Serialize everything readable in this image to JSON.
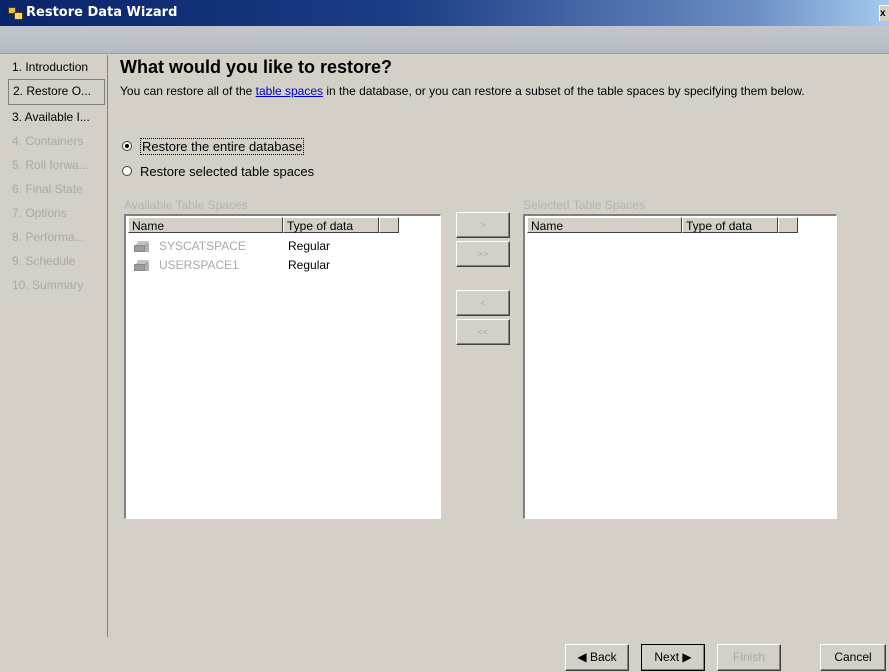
{
  "window": {
    "title": "Restore Data Wizard",
    "close_glyph": "x"
  },
  "nav": {
    "items": [
      {
        "label": "1. Introduction"
      },
      {
        "label": "2. Restore O..."
      },
      {
        "label": "3. Available I..."
      },
      {
        "label": "4. Containers"
      },
      {
        "label": "5. Roll forwa..."
      },
      {
        "label": "6. Final State"
      },
      {
        "label": "7. Options"
      },
      {
        "label": "8. Performa..."
      },
      {
        "label": "9. Schedule"
      },
      {
        "label": "10. Summary"
      }
    ]
  },
  "page": {
    "title": "What would you like to restore?",
    "desc_before": "You can restore all of the ",
    "desc_link": "table spaces",
    "desc_after": " in the database, or you can restore a subset of the table spaces by specifying them below."
  },
  "options": {
    "entire": "Restore the entire database",
    "selected": "Restore selected table spaces"
  },
  "available": {
    "label": "Available Table Spaces",
    "columns": [
      "Name",
      "Type of data"
    ],
    "rows": [
      {
        "name": "SYSCATSPACE",
        "type": "Regular"
      },
      {
        "name": "USERSPACE1",
        "type": "Regular"
      }
    ]
  },
  "selected": {
    "label": "Selected Table Spaces",
    "columns": [
      "Name",
      "Type of data"
    ]
  },
  "transfer": {
    "add": ">",
    "add_all": ">>",
    "remove": "<",
    "remove_all": "<<"
  },
  "buttons": {
    "back": "◀ Back",
    "next": "Next ▶",
    "finish": "Finish",
    "cancel": "Cancel"
  }
}
